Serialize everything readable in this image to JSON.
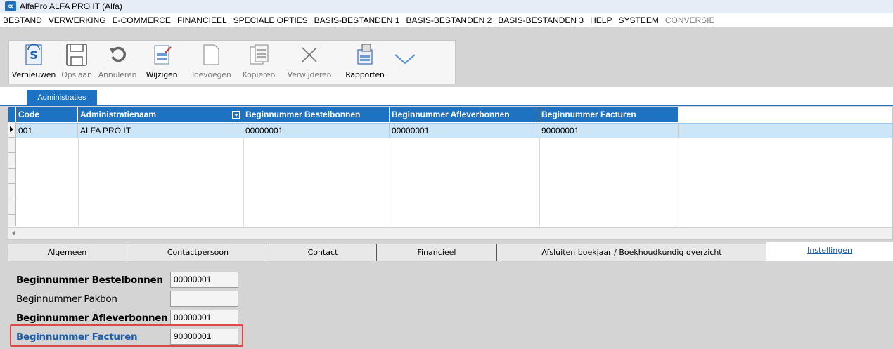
{
  "window": {
    "title": "AlfaPro ALFA PRO IT (Alfa)",
    "logo_glyph": "∝"
  },
  "menu": [
    {
      "label": "BESTAND",
      "disabled": false
    },
    {
      "label": "VERWERKING",
      "disabled": false
    },
    {
      "label": "E-COMMERCE",
      "disabled": false
    },
    {
      "label": "FINANCIEEL",
      "disabled": false
    },
    {
      "label": "SPECIALE OPTIES",
      "disabled": false
    },
    {
      "label": "BASIS-BESTANDEN 1",
      "disabled": false
    },
    {
      "label": "BASIS-BESTANDEN 2",
      "disabled": false
    },
    {
      "label": "BASIS-BESTANDEN 3",
      "disabled": false
    },
    {
      "label": "HELP",
      "disabled": false
    },
    {
      "label": "SYSTEEM",
      "disabled": false
    },
    {
      "label": "CONVERSIE",
      "disabled": true
    }
  ],
  "toolbar": {
    "refresh": "Vernieuwen",
    "save": "Opslaan",
    "cancel": "Annuleren",
    "edit": "Wijzigen",
    "add": "Toevoegen",
    "copy": "Kopieren",
    "delete": "Verwijderen",
    "reports": "Rapporten"
  },
  "top_tab": "Administraties",
  "grid": {
    "columns": [
      "Code",
      "Administratienaam",
      "Beginnummer Bestelbonnen",
      "Beginnummer Afleverbonnen",
      "Beginnummer Facturen"
    ],
    "rows": [
      [
        "001",
        "ALFA PRO IT",
        "00000001",
        "00000001",
        "90000001"
      ]
    ]
  },
  "bottom_tabs": [
    "Algemeen",
    "Contactpersoon",
    "Contact",
    "Financieel",
    "Afsluiten boekjaar / Boekhoudkundig overzicht",
    "Instellingen"
  ],
  "form": {
    "fields": [
      {
        "label": "Beginnummer Bestelbonnen",
        "value": "00000001"
      },
      {
        "label": "Beginnummer Pakbon",
        "value": ""
      },
      {
        "label": "Beginnummer Afleverbonnen",
        "value": "00000001"
      },
      {
        "label": "Beginnummer Facturen",
        "value": "90000001"
      }
    ]
  },
  "colors": {
    "accent": "#1d72c2",
    "selected_row": "#cde6f7",
    "highlight": "#e04848",
    "link": "#1d5fa8"
  }
}
